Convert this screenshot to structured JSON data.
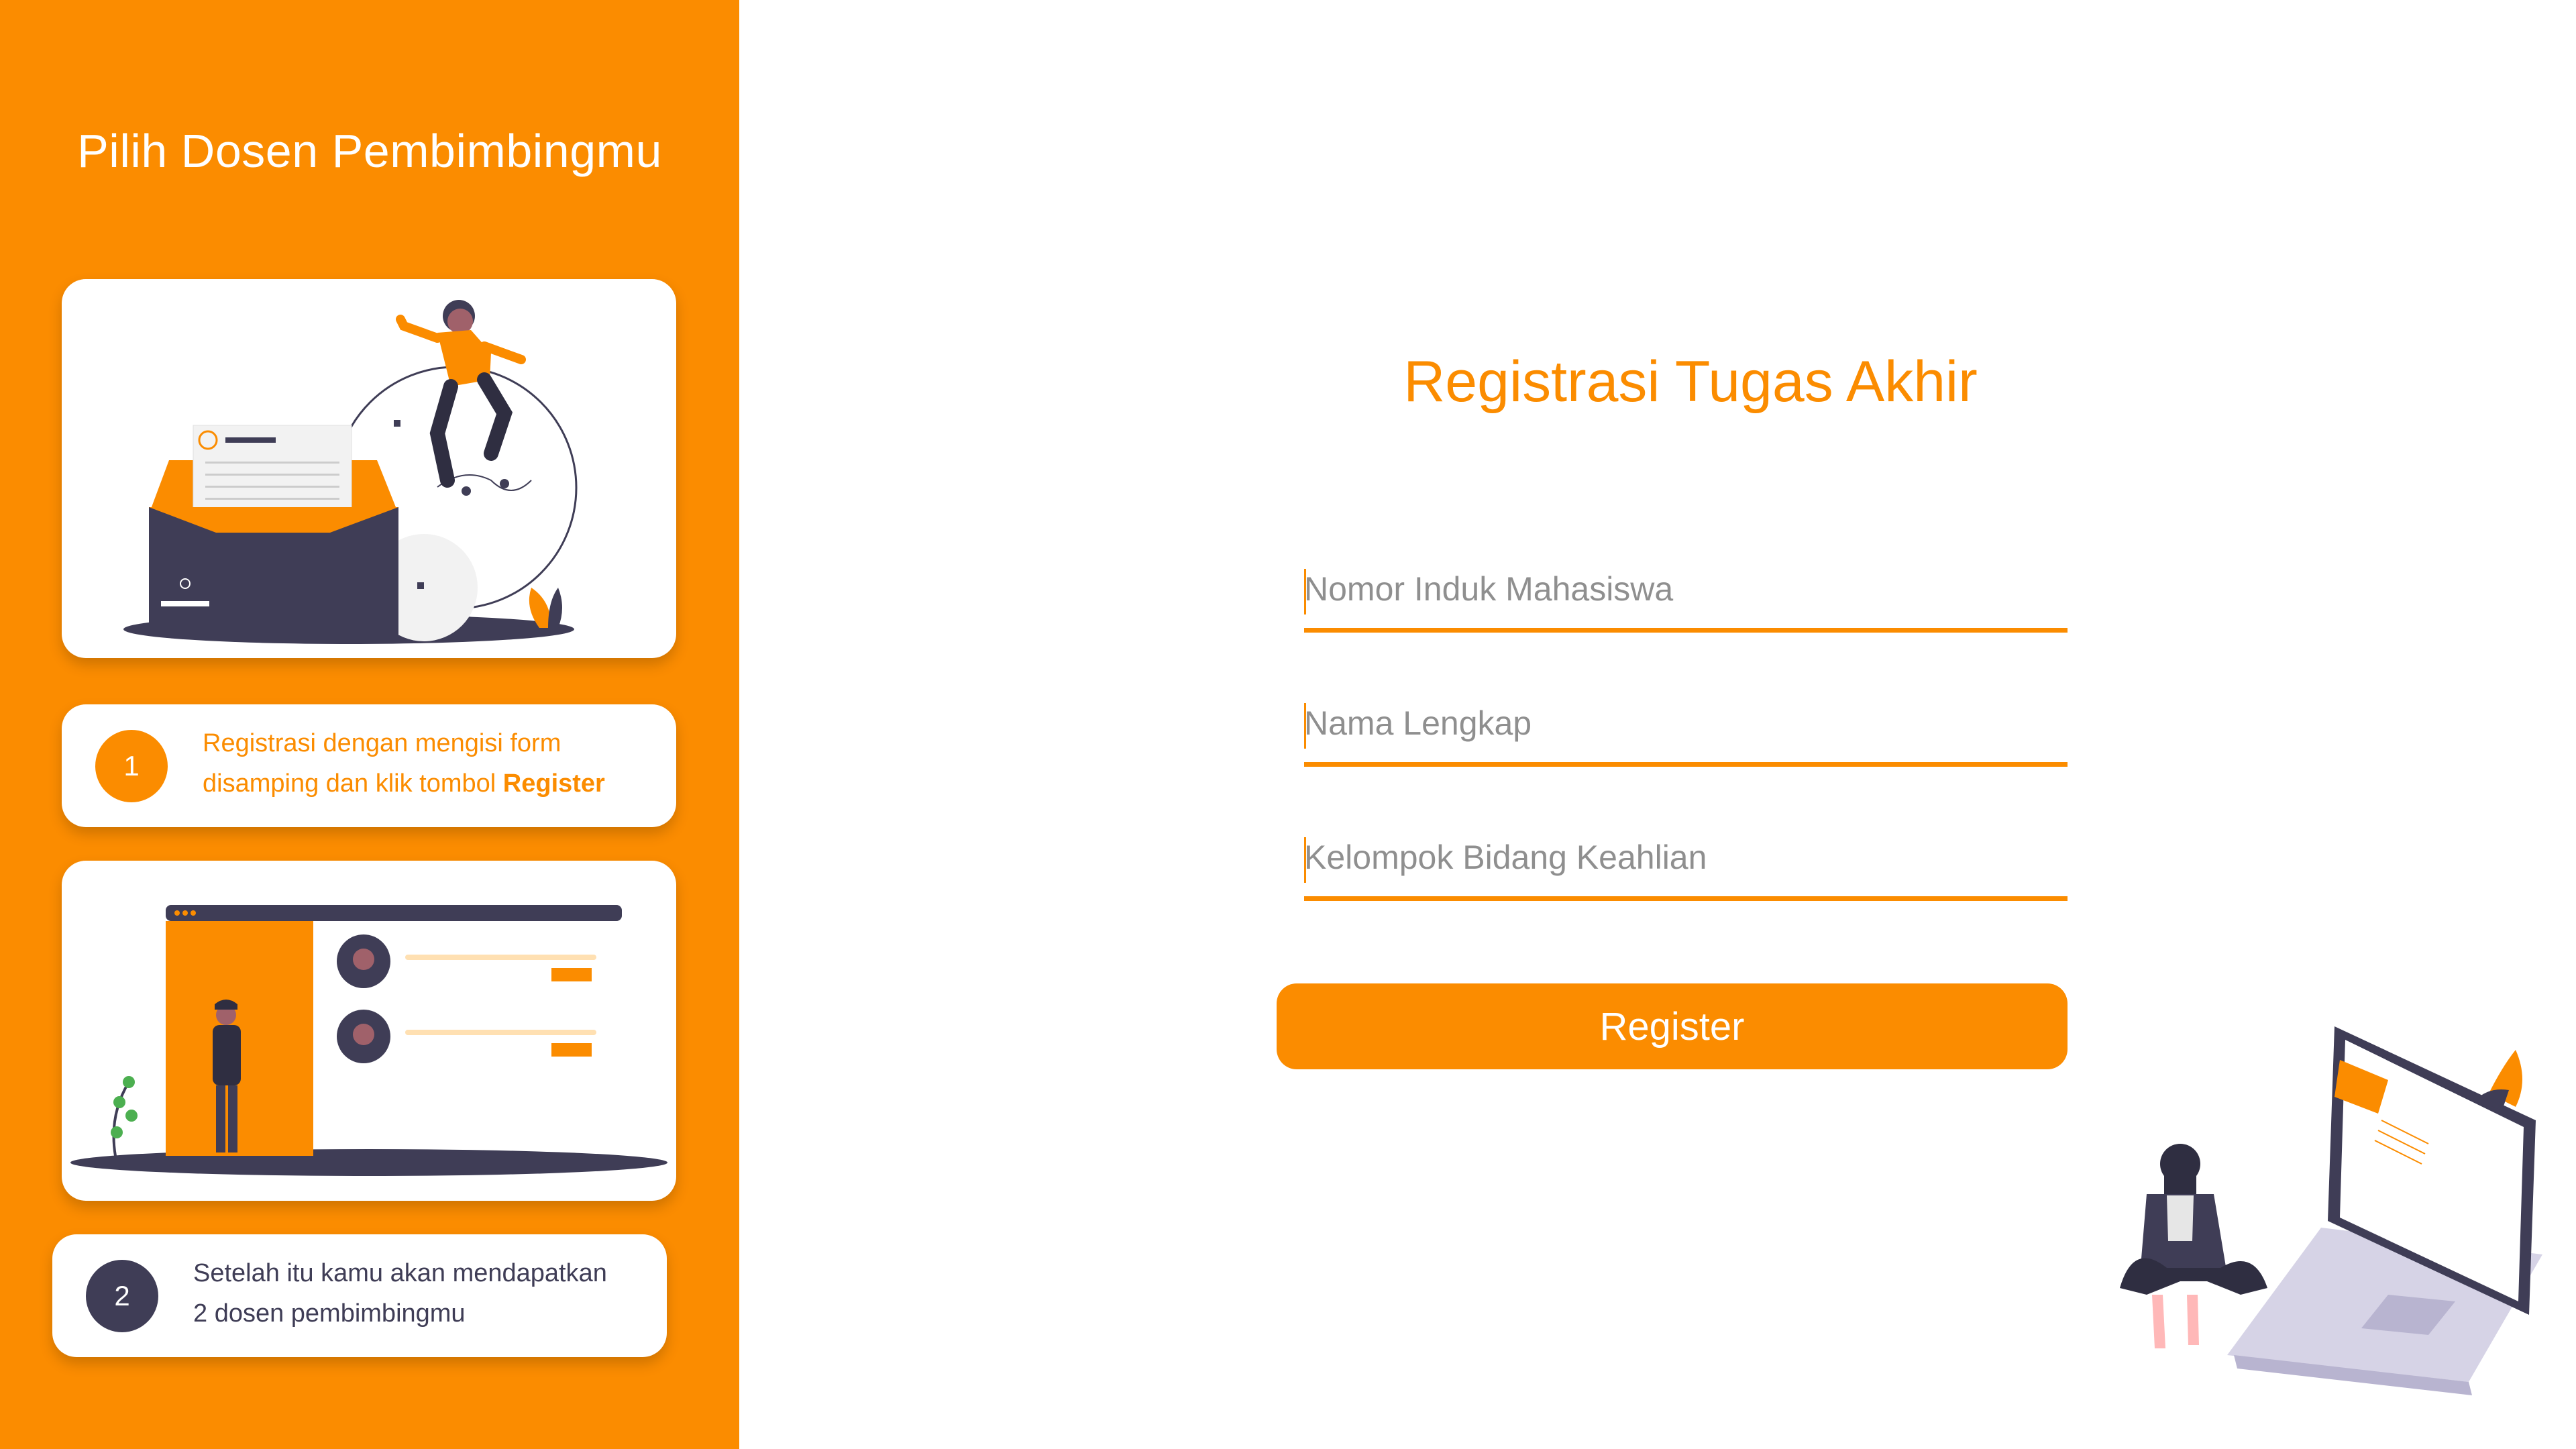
{
  "sidebar": {
    "title": "Pilih Dosen Pembimbingmu",
    "background": "#FB8C00",
    "steps": [
      {
        "number": "1",
        "text": "Registrasi dengan mengisi form disamping dan klik tombol ",
        "bold": "Register",
        "line1": "Registrasi dengan mengisi form",
        "line2_pre": "disamping dan klik tombol ",
        "circle_color": "#FB8C00",
        "text_color": "#FB8C00"
      },
      {
        "number": "2",
        "line1": "Setelah itu kamu akan mendapatkan",
        "line2": "2 dosen pembimbingmu",
        "circle_color": "#3F3D56",
        "text_color": "#3F3D56"
      }
    ]
  },
  "form": {
    "title": "Registrasi Tugas Akhir",
    "fields": [
      {
        "placeholder": "Nomor Induk Mahasiswa",
        "value": ""
      },
      {
        "placeholder": "Nama Lengkap",
        "value": ""
      },
      {
        "placeholder": "Kelompok Bidang Keahlian",
        "value": ""
      }
    ],
    "submit_label": "Register"
  },
  "colors": {
    "accent": "#FB8C00",
    "dark": "#3F3D56",
    "white": "#FFFFFF"
  },
  "icons": [
    "mail-envelope-illustration",
    "profile-list-illustration",
    "woman-laptop-illustration"
  ]
}
